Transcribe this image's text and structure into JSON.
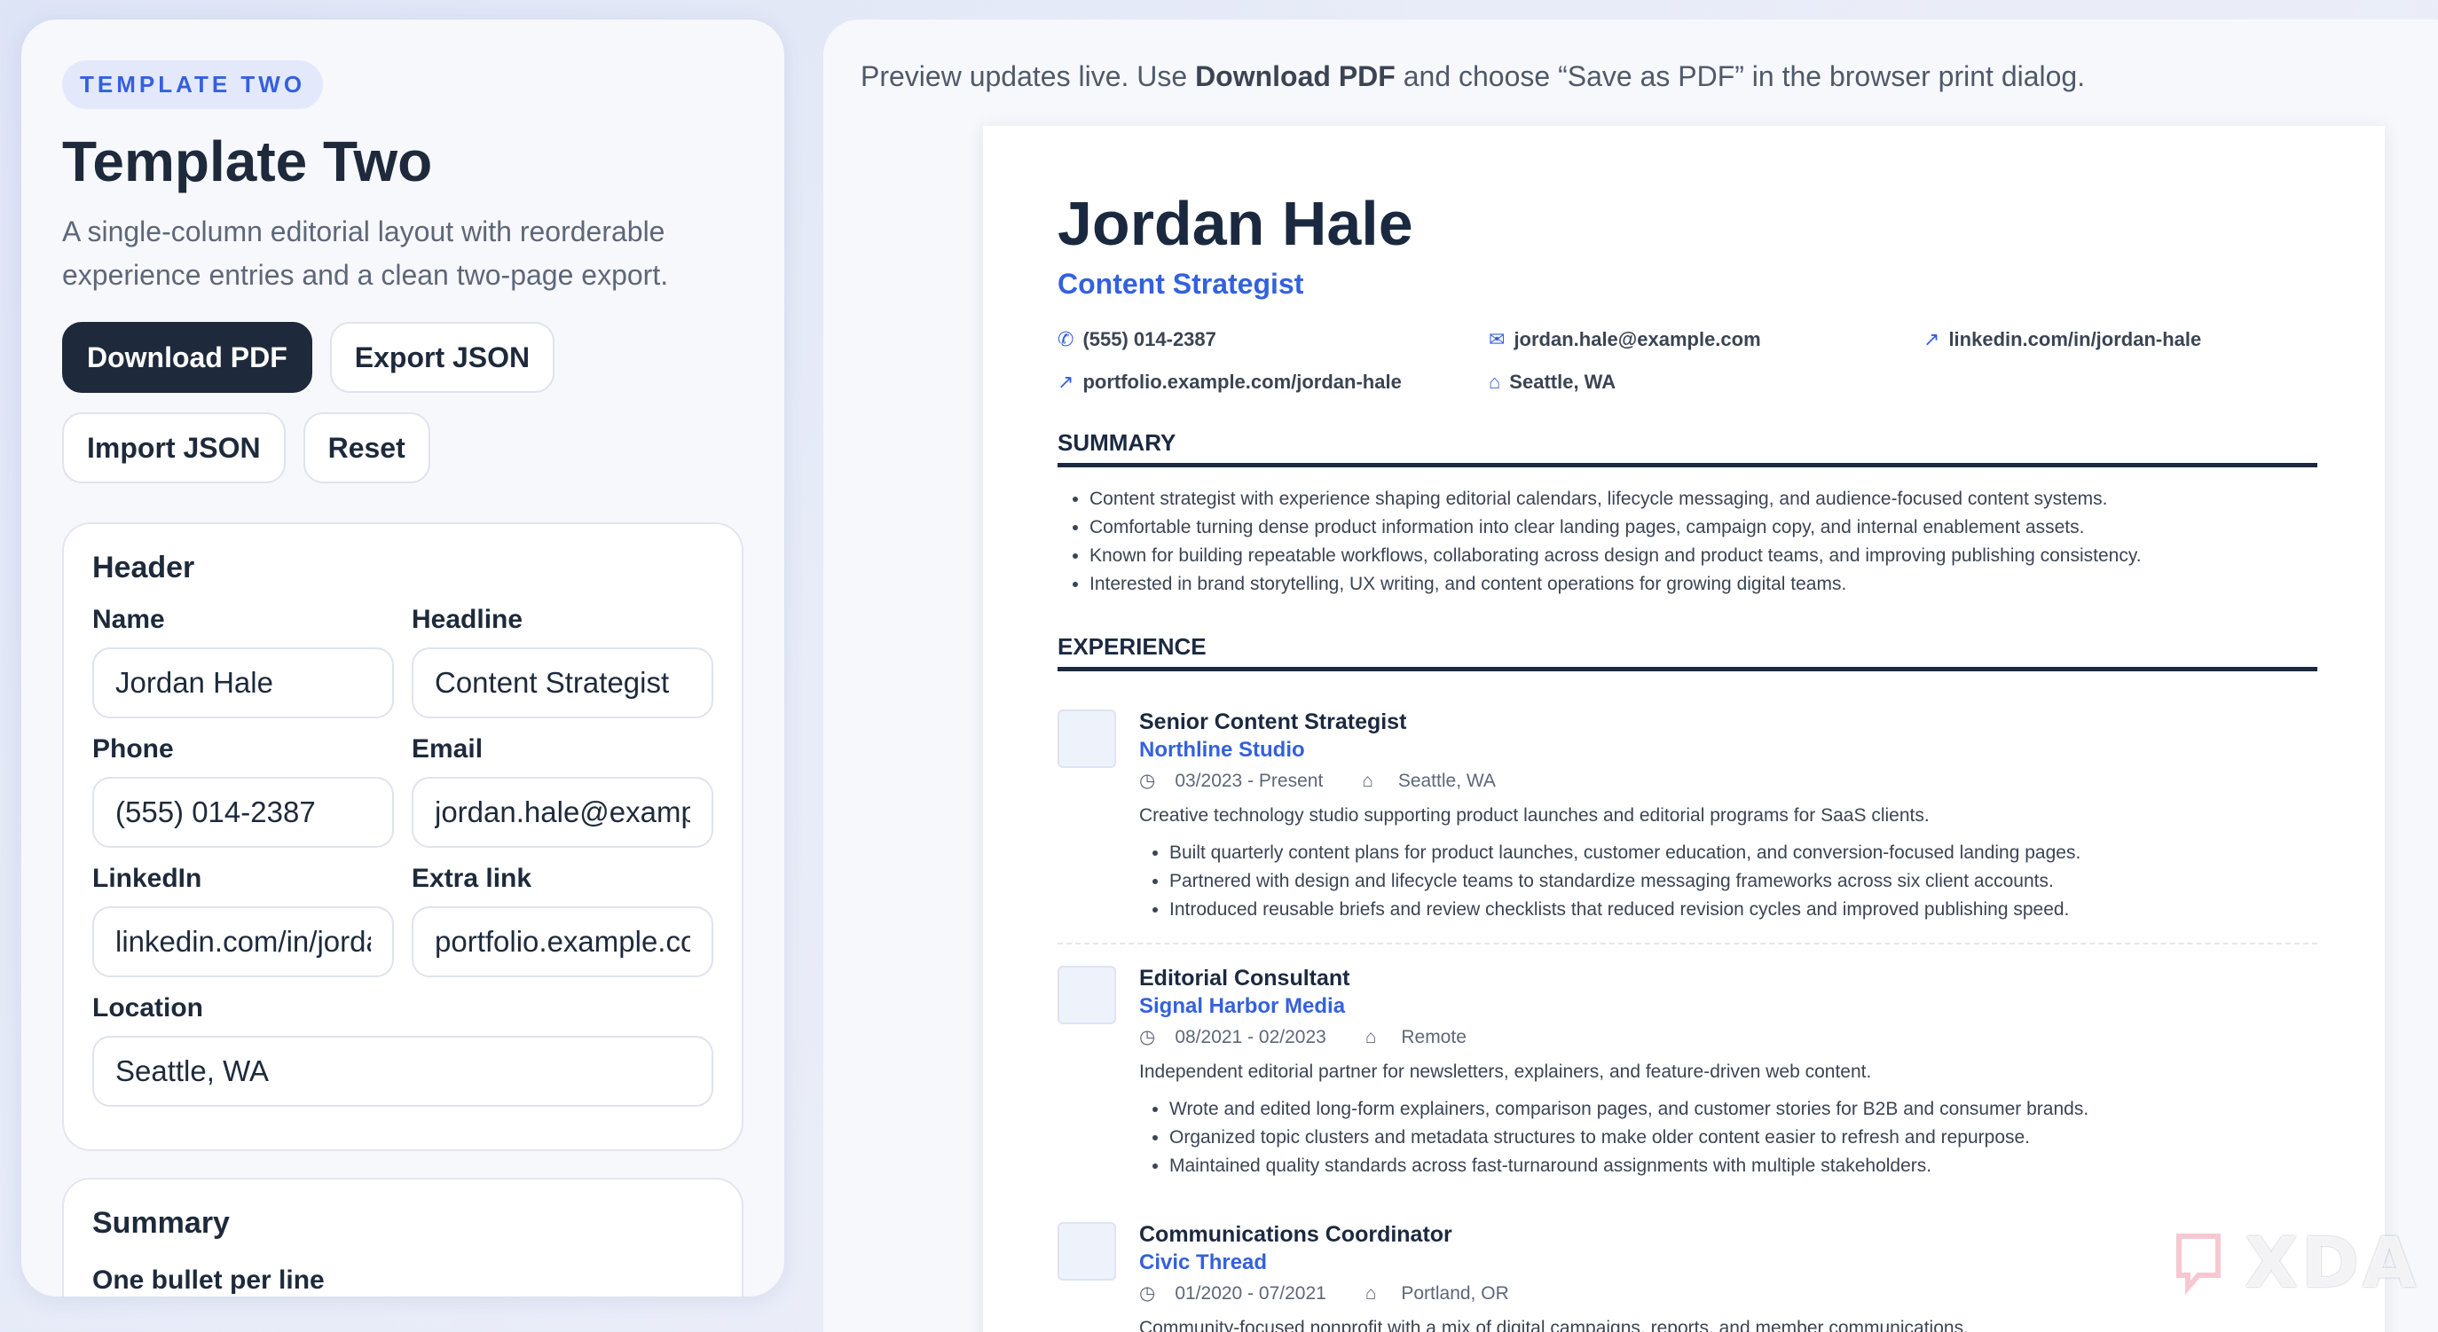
{
  "sidebar": {
    "pill": "TEMPLATE TWO",
    "title": "Template Two",
    "description": "A single-column editorial layout with reorderable experience entries and a clean two-page export.",
    "buttons": {
      "download": "Download PDF",
      "export": "Export JSON",
      "import": "Import JSON",
      "reset": "Reset"
    },
    "header_card": {
      "title": "Header",
      "name_label": "Name",
      "name_value": "Jordan Hale",
      "headline_label": "Headline",
      "headline_value": "Content Strategist",
      "phone_label": "Phone",
      "phone_value": "(555) 014-2387",
      "email_label": "Email",
      "email_value": "jordan.hale@example.com",
      "linkedin_label": "LinkedIn",
      "linkedin_value": "linkedin.com/in/jordan-hale",
      "extra_label": "Extra link",
      "extra_value": "portfolio.example.com/jordan-hale",
      "location_label": "Location",
      "location_value": "Seattle, WA"
    },
    "summary_card": {
      "title": "Summary",
      "sublabel": "One bullet per line"
    }
  },
  "preview": {
    "note_prefix": "Preview updates live. Use ",
    "note_bold": "Download PDF",
    "note_suffix": " and choose “Save as PDF” in the browser print dialog."
  },
  "resume": {
    "name": "Jordan Hale",
    "headline": "Content Strategist",
    "contacts": {
      "phone": "(555) 014-2387",
      "email": "jordan.hale@example.com",
      "linkedin": "linkedin.com/in/jordan-hale",
      "portfolio": "portfolio.example.com/jordan-hale",
      "location": "Seattle, WA"
    },
    "icons": {
      "phone": "phone-icon",
      "email": "mail-icon",
      "link": "link-arrow-icon",
      "location": "home-icon",
      "clock": "clock-icon"
    },
    "summary_title": "SUMMARY",
    "summary": [
      "Content strategist with experience shaping editorial calendars, lifecycle messaging, and audience-focused content systems.",
      "Comfortable turning dense product information into clear landing pages, campaign copy, and internal enablement assets.",
      "Known for building repeatable workflows, collaborating across design and product teams, and improving publishing consistency.",
      "Interested in brand storytelling, UX writing, and content operations for growing digital teams."
    ],
    "experience_title": "EXPERIENCE",
    "jobs": [
      {
        "title": "Senior Content Strategist",
        "company": "Northline Studio",
        "dates": "03/2023 - Present",
        "location": "Seattle, WA",
        "description": "Creative technology studio supporting product launches and editorial programs for SaaS clients.",
        "bullets": [
          "Built quarterly content plans for product launches, customer education, and conversion-focused landing pages.",
          "Partnered with design and lifecycle teams to standardize messaging frameworks across six client accounts.",
          "Introduced reusable briefs and review checklists that reduced revision cycles and improved publishing speed."
        ]
      },
      {
        "title": "Editorial Consultant",
        "company": "Signal Harbor Media",
        "dates": "08/2021 - 02/2023",
        "location": "Remote",
        "description": "Independent editorial partner for newsletters, explainers, and feature-driven web content.",
        "bullets": [
          "Wrote and edited long-form explainers, comparison pages, and customer stories for B2B and consumer brands.",
          "Organized topic clusters and metadata structures to make older content easier to refresh and repurpose.",
          "Maintained quality standards across fast-turnaround assignments with multiple stakeholders."
        ]
      },
      {
        "title": "Communications Coordinator",
        "company": "Civic Thread",
        "dates": "01/2020 - 07/2021",
        "location": "Portland, OR",
        "description": "Community-focused nonprofit with a mix of digital campaigns, reports, and member communications."
      }
    ]
  },
  "watermark": "XDA",
  "colors": {
    "accent": "#3461dc",
    "dark": "#1e2a3b"
  }
}
